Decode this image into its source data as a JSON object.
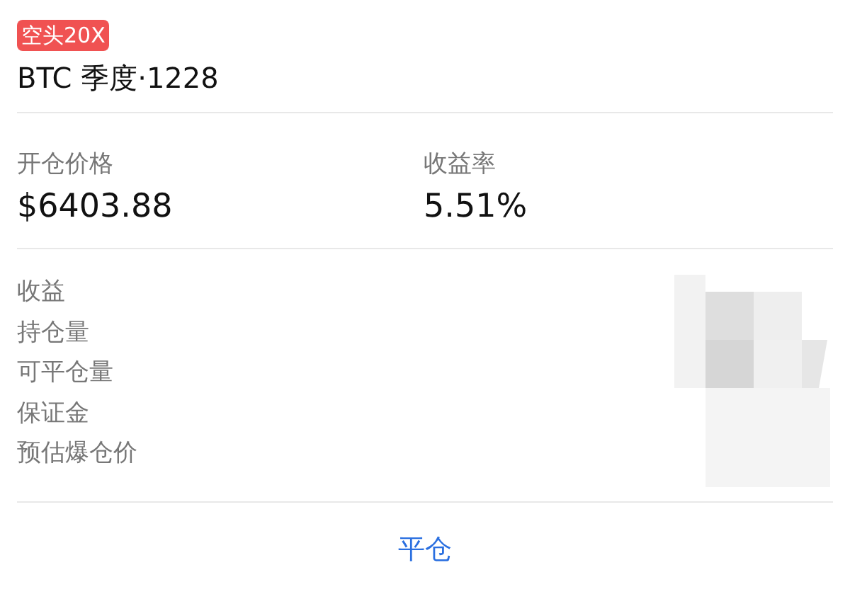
{
  "position": {
    "side_badge": "空头20X",
    "contract": "BTC 季度·1228"
  },
  "summary": [
    {
      "label": "开仓价格",
      "value": "$6403.88"
    },
    {
      "label": "收益率",
      "value": "5.51%"
    }
  ],
  "details": [
    {
      "label": "收益"
    },
    {
      "label": "持仓量"
    },
    {
      "label": "可平仓量"
    },
    {
      "label": "保证金"
    },
    {
      "label": "预估爆仓价"
    }
  ],
  "close_button": "平仓"
}
